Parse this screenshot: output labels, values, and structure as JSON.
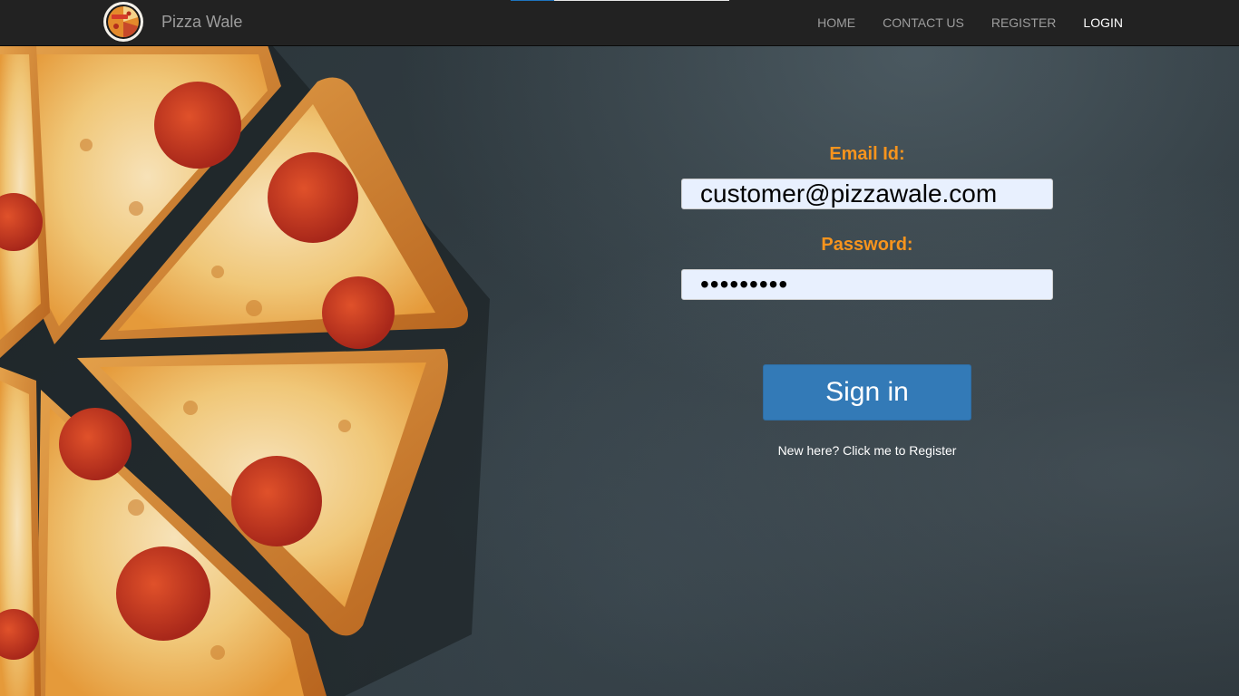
{
  "brand": {
    "name": "Pizza Wale",
    "logo_icon": "pizza-logo-icon"
  },
  "nav": {
    "items": [
      {
        "label": "HOME",
        "active": false
      },
      {
        "label": "CONTACT US",
        "active": false
      },
      {
        "label": "REGISTER",
        "active": false
      },
      {
        "label": "LOGIN",
        "active": true
      }
    ],
    "loading_progress": 0.2
  },
  "login": {
    "email_label": "Email Id:",
    "email_value": "customer@pizzawale.com",
    "password_label": "Password:",
    "password_value": "123456789",
    "submit_label": "Sign in",
    "register_link": "New here? Click me to Register"
  },
  "colors": {
    "navbar": "#222222",
    "label_accent": "#f7941d",
    "button": "#337ab7",
    "input_bg": "#e8f0fe",
    "active_nav": "#ffffff",
    "inactive_nav": "#9d9d9d"
  }
}
